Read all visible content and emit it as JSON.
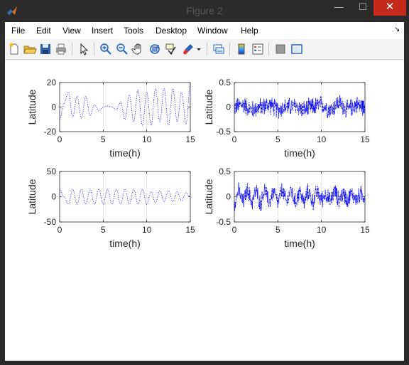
{
  "window": {
    "title": "Figure 2",
    "minimize": "—",
    "maximize": "☐",
    "close": "✕"
  },
  "menu": {
    "items": [
      "File",
      "Edit",
      "View",
      "Insert",
      "Tools",
      "Desktop",
      "Window",
      "Help"
    ],
    "dock_arrow": "↘"
  },
  "toolbar": {
    "icons": [
      "new-figure-icon",
      "open-file-icon",
      "save-icon",
      "print-icon",
      "pointer-icon",
      "zoom-in-icon",
      "zoom-out-icon",
      "pan-icon",
      "rotate-3d-icon",
      "data-cursor-icon",
      "brush-icon",
      "dropdown-arrow-icon",
      "link-plot-icon",
      "colorbar-icon",
      "legend-icon",
      "hide-plot-tools-icon",
      "show-plot-tools-icon"
    ]
  },
  "colors": {
    "series": "#0000ff",
    "titlebar": "#2b2b2b",
    "close": "#c42b1c"
  },
  "chart_data": [
    {
      "type": "line",
      "position": "top-left",
      "xlabel": "time(h)",
      "ylabel": "Latitude",
      "xlim": [
        0,
        15
      ],
      "ylim": [
        -20,
        20
      ],
      "xticks": [
        "0",
        "5",
        "10",
        "15"
      ],
      "yticks": [
        "-20",
        "0",
        "20"
      ],
      "grid": "x",
      "x": [
        0,
        0.5,
        1,
        1.5,
        2,
        2.5,
        3,
        3.5,
        4,
        4.5,
        5,
        5.5,
        6,
        6.5,
        7,
        7.5,
        8,
        8.5,
        9,
        9.5,
        10,
        10.5,
        11,
        11.5,
        12,
        12.5,
        13,
        13.5,
        14,
        14.5,
        15
      ],
      "y": [
        -10,
        3,
        12,
        -8,
        9,
        -9,
        9,
        -7,
        2,
        -3,
        0,
        1,
        0,
        -2,
        4,
        -10,
        10,
        -12,
        14,
        -15,
        12,
        -15,
        15,
        -12,
        15,
        -15,
        15,
        -12,
        12,
        -14,
        18
      ]
    },
    {
      "type": "line",
      "position": "top-right",
      "xlabel": "time(h)",
      "ylabel": "Latitude",
      "xlim": [
        0,
        15
      ],
      "ylim": [
        -0.5,
        0.5
      ],
      "xticks": [
        "0",
        "5",
        "10",
        "15"
      ],
      "yticks": [
        "-0.5",
        "0",
        "0.5"
      ],
      "grid": "x",
      "noise_amplitude": 0.22,
      "x": [
        0,
        1,
        2,
        3,
        4,
        5,
        6,
        7,
        8,
        9,
        10,
        11,
        12,
        13,
        14,
        15
      ],
      "y": [
        0.0,
        0.05,
        -0.05,
        0.0,
        0.05,
        -0.05,
        0.0,
        0.02,
        -0.05,
        0.0,
        0.05,
        -0.05,
        0.08,
        -0.05,
        0.05,
        0.0
      ]
    },
    {
      "type": "line",
      "position": "bottom-left",
      "xlabel": "time(h)",
      "ylabel": "Latitude",
      "xlim": [
        0,
        15
      ],
      "ylim": [
        -50,
        50
      ],
      "xticks": [
        "0",
        "5",
        "10",
        "15"
      ],
      "yticks": [
        "-50",
        "0",
        "50"
      ],
      "grid": "x",
      "x": [
        0,
        0.5,
        1,
        1.5,
        2,
        2.5,
        3,
        3.5,
        4,
        4.5,
        5,
        5.5,
        6,
        6.5,
        7,
        7.5,
        8,
        8.5,
        9,
        9.5,
        10,
        10.5,
        11,
        11.5,
        12,
        12.5,
        13,
        13.5,
        14,
        14.5,
        15
      ],
      "y": [
        15,
        0,
        -15,
        15,
        -15,
        15,
        -15,
        15,
        -15,
        15,
        -15,
        15,
        -15,
        15,
        -15,
        15,
        -15,
        15,
        -15,
        15,
        -15,
        10,
        -12,
        12,
        -10,
        12,
        -10,
        10,
        -8,
        8,
        0
      ]
    },
    {
      "type": "line",
      "position": "bottom-right",
      "xlabel": "time(h)",
      "ylabel": "Latitude",
      "xlim": [
        0,
        15
      ],
      "ylim": [
        -0.5,
        0.5
      ],
      "xticks": [
        "0",
        "5",
        "10",
        "15"
      ],
      "yticks": [
        "-0.5",
        "0",
        "0.5"
      ],
      "grid": "x",
      "noise_amplitude": 0.2,
      "x": [
        0,
        0.5,
        1,
        1.5,
        2,
        2.5,
        3,
        3.5,
        4,
        4.5,
        5,
        5.5,
        6,
        6.5,
        7,
        7.5,
        8,
        8.5,
        9,
        9.5,
        10,
        10.5,
        11,
        11.5,
        12,
        12.5,
        13,
        13.5,
        14,
        14.5,
        15
      ],
      "y": [
        -0.1,
        0.1,
        -0.1,
        0.12,
        -0.1,
        0.1,
        -0.12,
        0.12,
        -0.1,
        0.1,
        -0.1,
        0.12,
        -0.1,
        0.12,
        -0.1,
        0.1,
        -0.1,
        0.1,
        -0.1,
        0.08,
        -0.05,
        0.05,
        -0.08,
        0.1,
        -0.05,
        0.05,
        -0.05,
        0.05,
        -0.05,
        0.05,
        0.0
      ]
    }
  ]
}
